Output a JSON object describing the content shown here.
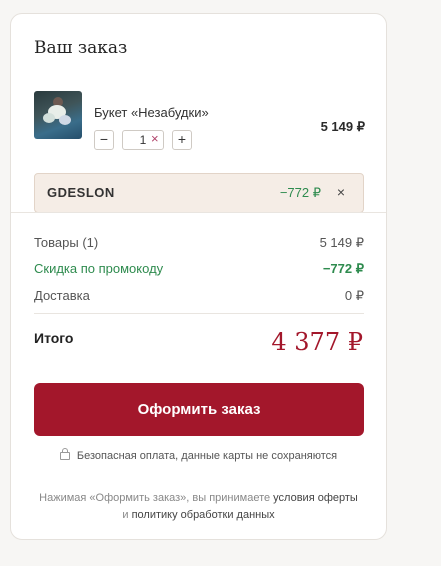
{
  "order": {
    "title": "Ваш заказ",
    "item": {
      "name": "Букет «Незабудки»",
      "quantity": "1",
      "minus": "−",
      "plus": "+",
      "remove": "×",
      "price": "5 149 ₽"
    },
    "promo": {
      "code": "GDESLON",
      "amount": "−772 ₽",
      "remove": "×"
    },
    "summary": {
      "goods_label": "Товары (1)",
      "goods_value": "5 149 ₽",
      "discount_label": "Скидка по промокоду",
      "discount_value": "−772 ₽",
      "delivery_label": "Доставка",
      "delivery_value": "0 ₽"
    },
    "total": {
      "label": "Итого",
      "value": "4 377 ₽"
    },
    "checkout_label": "Оформить заказ",
    "secure_note": "Безопасная оплата, данные карты не сохраняются",
    "legal": {
      "prefix": "Нажимая «Оформить заказ», вы принимаете",
      "terms_link": "условия оферты",
      "and": "и",
      "privacy_link": "политику обработки данных"
    }
  },
  "colors": {
    "accent": "#a3172b",
    "discount": "#2e8b4e",
    "promo_bg": "#f5ede6"
  },
  "icons": [
    "minus-icon",
    "plus-icon",
    "close-icon",
    "lock-icon"
  ]
}
